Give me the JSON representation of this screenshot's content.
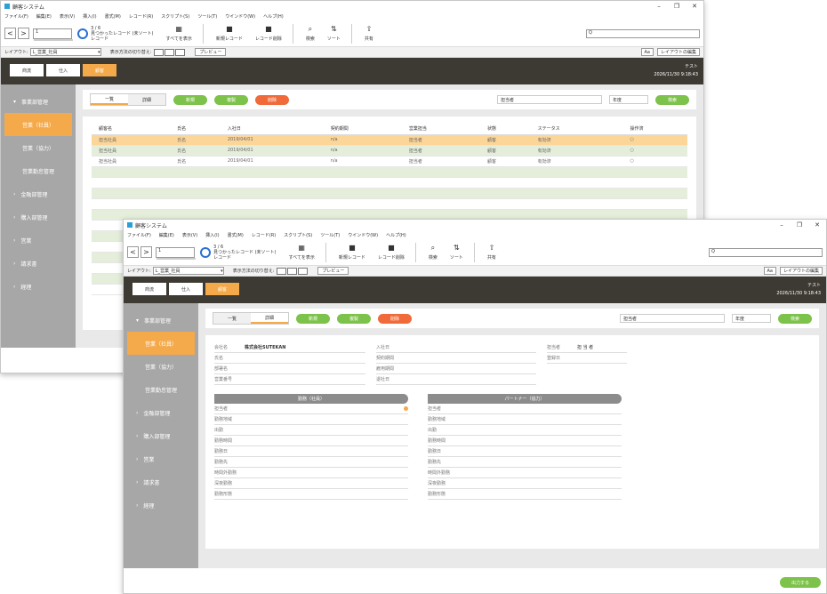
{
  "app": {
    "title": "顧客システム",
    "window_controls": [
      "–",
      "❐",
      "✕"
    ]
  },
  "menu": [
    "ファイル(F)",
    "編集(E)",
    "表示(V)",
    "挿入(I)",
    "書式(M)",
    "レコード(R)",
    "スクリプト(S)",
    "ツール(T)",
    "ウインドウ(W)",
    "ヘルプ(H)"
  ],
  "toolbar": {
    "back": "<",
    "forward": ">",
    "record_page": "1",
    "record_fraction": 0.02,
    "record_total": "3 / 6",
    "record_found": "見つかったレコード (未ソート)",
    "record_label": "レコード",
    "show_all": "すべてを表示",
    "new_record": "新規レコード",
    "delete_record": "レコード削除",
    "find": "検索",
    "sort": "ソート",
    "share": "共有",
    "search_placeholder": "Q"
  },
  "layoutbar": {
    "layout_label": "レイアウト:",
    "layout_value": "L_営業_社員",
    "view_label": "表示方法の切り替え:",
    "preview": "プレビュー",
    "aa": "Aa",
    "edit_layout": "レイアウトの編集"
  },
  "header": {
    "buttons": [
      "商流",
      "仕入",
      "顧客"
    ],
    "active": 2,
    "user": "テスト",
    "datetime": "2026/11/30 9:18:43"
  },
  "sidebar": {
    "section_open": "事業部管理",
    "subs": [
      "営業（社員）",
      "営業（協力）",
      "営業勤怠管理"
    ],
    "active_sub": 0,
    "sections": [
      "金融部管理",
      "購入部管理",
      "営業",
      "請求書",
      "経理"
    ]
  },
  "list_view": {
    "tabs": [
      "一覧",
      "詳細"
    ],
    "active_tab": 0,
    "actions": [
      "新規",
      "複製",
      "削除"
    ],
    "filter1": "担当者",
    "filter2": "年度",
    "search_btn": "検索",
    "columns": [
      "顧客名",
      "氏名",
      "入社日",
      "契約期間",
      "営業担当",
      "状態",
      "ステータス",
      "操作済"
    ],
    "rows": [
      [
        "担当社員",
        "氏名",
        "2019/04/01",
        "n/a",
        "担当者",
        "顧客",
        "有効済",
        "○"
      ],
      [
        "担当社員",
        "氏名",
        "2019/04/01",
        "n/a",
        "担当者",
        "顧客",
        "有効済",
        "○"
      ],
      [
        "担当社員",
        "氏名",
        "2019/04/01",
        "n/a",
        "担当者",
        "顧客",
        "有効済",
        "○"
      ]
    ]
  },
  "detail_view": {
    "tabs": [
      "一覧",
      "詳細"
    ],
    "active_tab": 1,
    "actions": [
      "新規",
      "複製",
      "削除"
    ],
    "filter1": "担当者",
    "filter2": "年度",
    "search_btn": "検索",
    "company_label": "会社名",
    "company_value": "株式会社SUTEKAN",
    "owner_label": "担当者",
    "owner_value": "担 当 者",
    "left_fields": [
      "氏名",
      "部署名",
      "営業番号"
    ],
    "mid_fields": [
      "入社日",
      "契約期間",
      "雇用期間",
      "退社日"
    ],
    "right_fields": [
      "登録日"
    ],
    "section_left": "勤務（社員）",
    "section_right": "パートナー（協力）",
    "left_section_fields": [
      "担当者",
      "勤務地域",
      "出勤",
      "勤務時間",
      "勤務日",
      "勤務先",
      "時間外勤務",
      "深夜勤務",
      "勤務形態"
    ],
    "right_section_fields": [
      "担当者",
      "勤務地域",
      "出勤",
      "勤務時間",
      "勤務日",
      "勤務先",
      "時間外勤務",
      "深夜勤務",
      "勤務形態"
    ],
    "output_btn": "出力する"
  }
}
